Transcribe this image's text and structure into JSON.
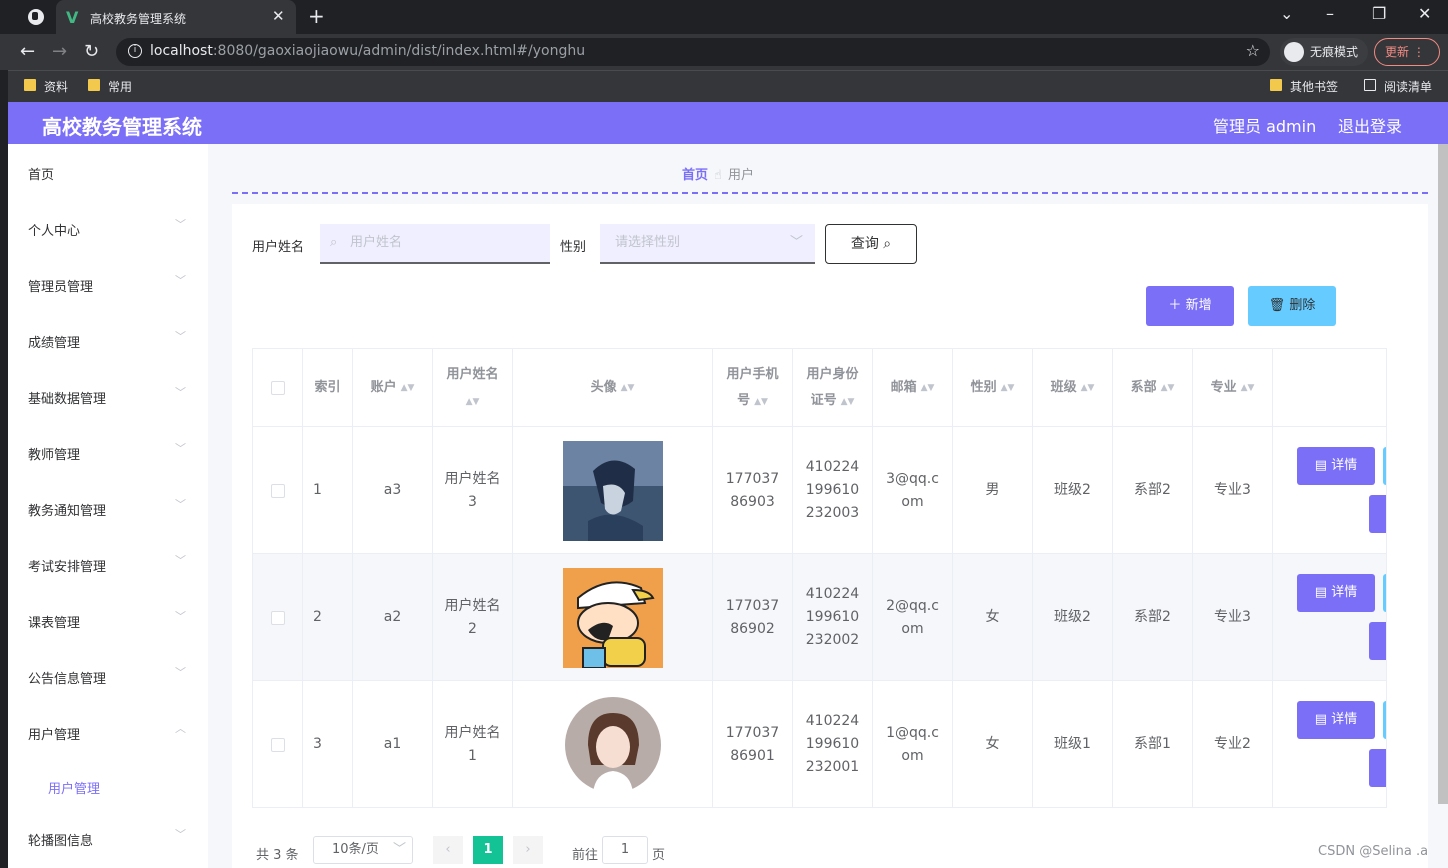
{
  "browser": {
    "tab_title": "高校教务管理系统",
    "url_host": "localhost",
    "url_rest": ":8080/gaoxiaojiaowu/admin/dist/index.html#/yonghu",
    "incognito_label": "无痕模式",
    "update_label": "更新",
    "bookmarks": [
      "资料",
      "常用"
    ],
    "bookmarks_right": [
      "其他书签",
      "阅读清单"
    ]
  },
  "header": {
    "brand": "高校教务管理系统",
    "user": "管理员 admin",
    "logout": "退出登录"
  },
  "sidebar": {
    "items": [
      "首页",
      "个人中心",
      "管理员管理",
      "成绩管理",
      "基础数据管理",
      "教师管理",
      "教务通知管理",
      "考试安排管理",
      "课表管理",
      "公告信息管理",
      "用户管理",
      "轮播图信息"
    ],
    "sub_item": "用户管理"
  },
  "breadcrumb": {
    "home": "首页",
    "current": "用户"
  },
  "search": {
    "name_label": "用户姓名",
    "name_placeholder": "用户姓名",
    "gender_label": "性别",
    "gender_placeholder": "请选择性别",
    "query_label": "查询"
  },
  "actions": {
    "add": "新增",
    "delete": "删除"
  },
  "table": {
    "headers": [
      "索引",
      "账户",
      "用户姓名",
      "头像",
      "用户手机号",
      "用户身份证号",
      "邮箱",
      "性别",
      "班级",
      "系部",
      "专业"
    ],
    "rows": [
      {
        "index": "1",
        "account": "a3",
        "name": "用户姓名3",
        "phone": "17703786903",
        "idcard": "410224199610232003",
        "email": "3@qq.com",
        "gender": "男",
        "class": "班级2",
        "dept": "系部2",
        "major": "专业3"
      },
      {
        "index": "2",
        "account": "a2",
        "name": "用户姓名2",
        "phone": "17703786902",
        "idcard": "410224199610232002",
        "email": "2@qq.com",
        "gender": "女",
        "class": "班级2",
        "dept": "系部2",
        "major": "专业3"
      },
      {
        "index": "3",
        "account": "a1",
        "name": "用户姓名1",
        "phone": "17703786901",
        "idcard": "410224199610232001",
        "email": "1@qq.com",
        "gender": "女",
        "class": "班级1",
        "dept": "系部1",
        "major": "专业2"
      }
    ],
    "detail_label": "详情"
  },
  "pagination": {
    "total": "共 3 条",
    "page_size": "10条/页",
    "current": "1",
    "goto": "前往",
    "goto_value": "1",
    "page_unit": "页"
  },
  "watermark": "CSDN @Selina .a",
  "colors": {
    "accent": "#7b6ff8",
    "secondary": "#66ccff"
  }
}
